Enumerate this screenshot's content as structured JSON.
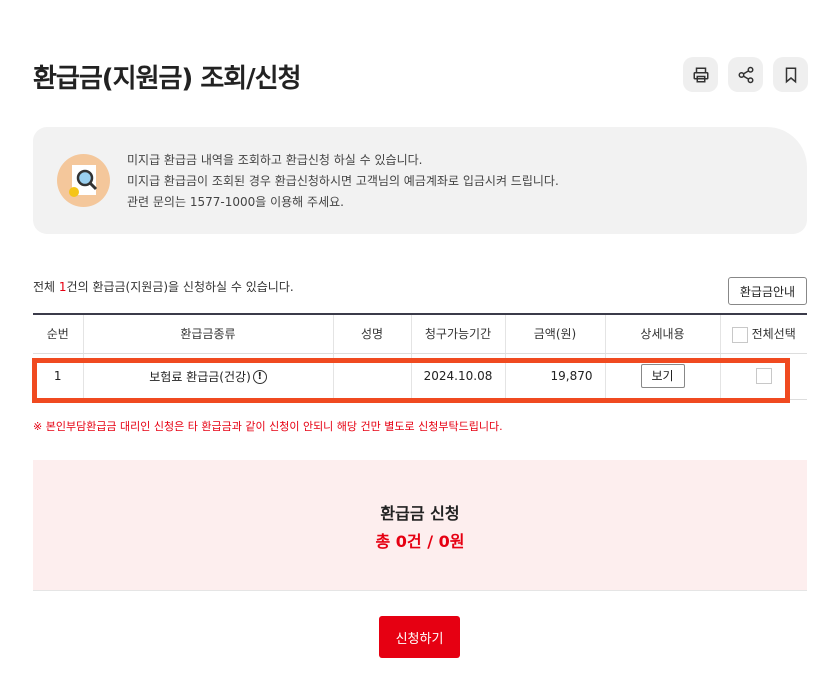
{
  "page": {
    "title": "환급금(지원금) 조회/신청"
  },
  "toolbar": {
    "print_icon": "printer-icon",
    "share_icon": "share-icon",
    "bookmark_icon": "bookmark-icon"
  },
  "info": {
    "icon": "magnifier-document-icon",
    "lines": [
      "미지급 환급금 내역을 조회하고 환급신청 하실 수 있습니다.",
      "미지급 환급금이 조회된 경우 환급신청하시면 고객님의 예금계좌로 입금시켜 드립니다.",
      "관련 문의는 1577-1000을 이용해 주세요."
    ]
  },
  "count": {
    "prefix": "전체 ",
    "num": "1",
    "suffix": "건의 환급금(지원금)을 신청하실 수 있습니다."
  },
  "guide_button": "환급금안내",
  "table": {
    "headers": [
      "순번",
      "환급금종류",
      "성명",
      "청구가능기간",
      "금액(원)",
      "상세내용",
      "전체선택"
    ],
    "rows": [
      {
        "no": "1",
        "type": "보험료 환급금(건강)",
        "name": "",
        "period": "2024.10.08",
        "amount": "19,870",
        "detail": "보기"
      }
    ]
  },
  "notice": "※ 본인부담환급금 대리인 신청은 타 환급금과 같이 신청이 안되니 해당 건만 별도로 신청부탁드립니다.",
  "summary": {
    "title": "환급금 신청",
    "total": "총 0건 / 0원"
  },
  "apply_button": "신청하기",
  "colors": {
    "accent": "#e60012",
    "highlight": "#f04a20",
    "summary_bg": "#fdeeee"
  }
}
